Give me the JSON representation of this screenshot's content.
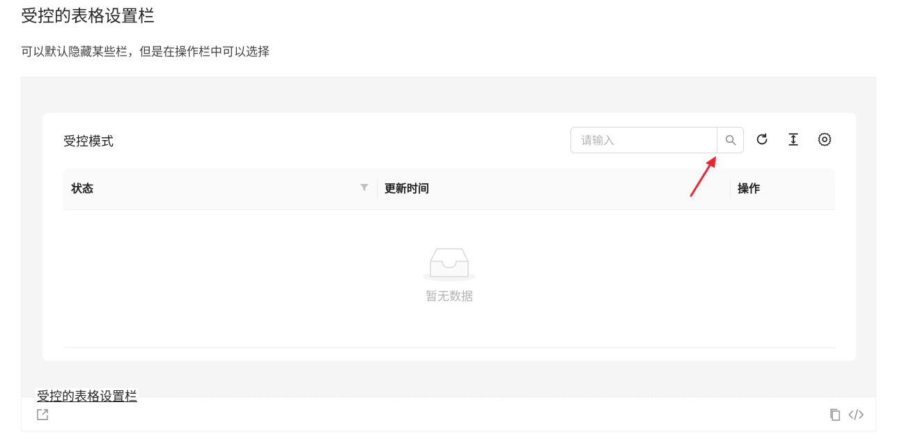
{
  "page": {
    "title": "受控的表格设置栏",
    "description": "可以默认隐藏某些栏，但是在操作栏中可以选择"
  },
  "card": {
    "title": "受控模式",
    "search": {
      "placeholder": "请输入",
      "value": ""
    },
    "toolbar": {
      "search_icon": "search-icon",
      "reload_icon": "reload-icon",
      "density_icon": "column-height-icon",
      "settings_icon": "setting-icon"
    }
  },
  "table": {
    "columns": [
      {
        "label": "状态",
        "filter": true
      },
      {
        "label": "更新时间",
        "filter": false
      },
      {
        "label": "操作",
        "filter": false
      }
    ],
    "rows": [],
    "empty_text": "暂无数据"
  },
  "demo_footer": {
    "title": "受控的表格设置栏",
    "open_icon": "external-link-icon",
    "copy_icon": "copy-icon",
    "code_icon": "code-icon"
  },
  "colors": {
    "annotation_arrow": "#f5222d",
    "preview_bg": "#f5f5f5",
    "header_bg": "#fafafa"
  }
}
